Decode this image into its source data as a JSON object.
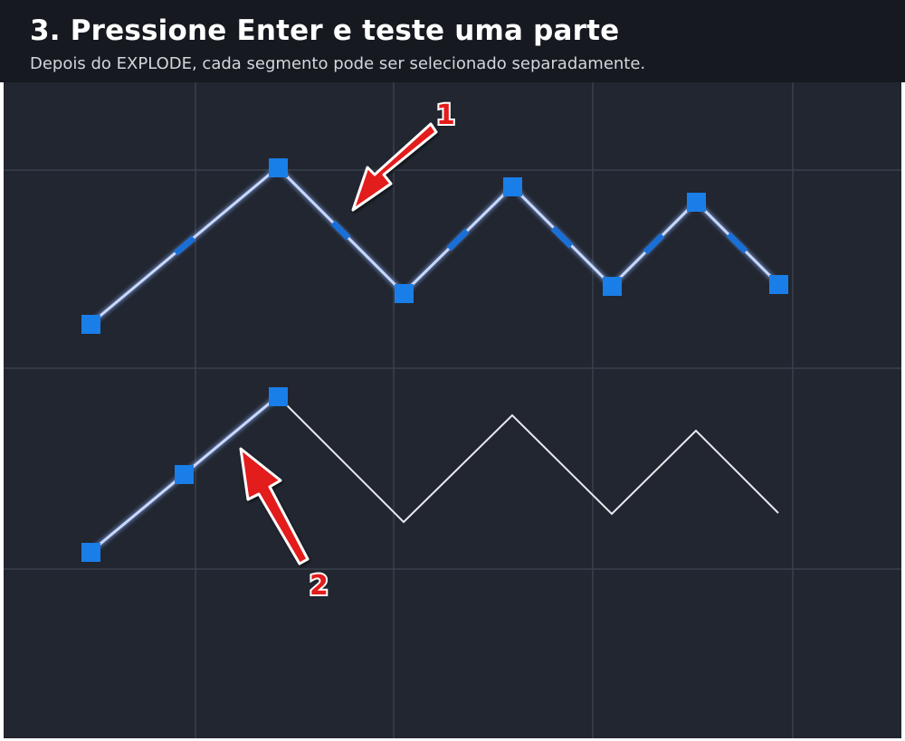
{
  "header": {
    "title": "3. Pressione Enter e teste uma parte",
    "subtitle": "Depois do EXPLODE, cada segmento pode ser selecionado separadamente."
  },
  "canvas": {
    "background_color": "#212630",
    "grid_color": "#3a404c",
    "line_color": "#e8eaee",
    "selection_color": "#1a7ee8",
    "highlight_color": "#8fb4ff"
  },
  "callouts": [
    {
      "label": "1",
      "icon": "red-arrow-icon",
      "color": "#e31b1b"
    },
    {
      "label": "2",
      "icon": "red-arrow-icon",
      "color": "#e31b1b"
    }
  ]
}
